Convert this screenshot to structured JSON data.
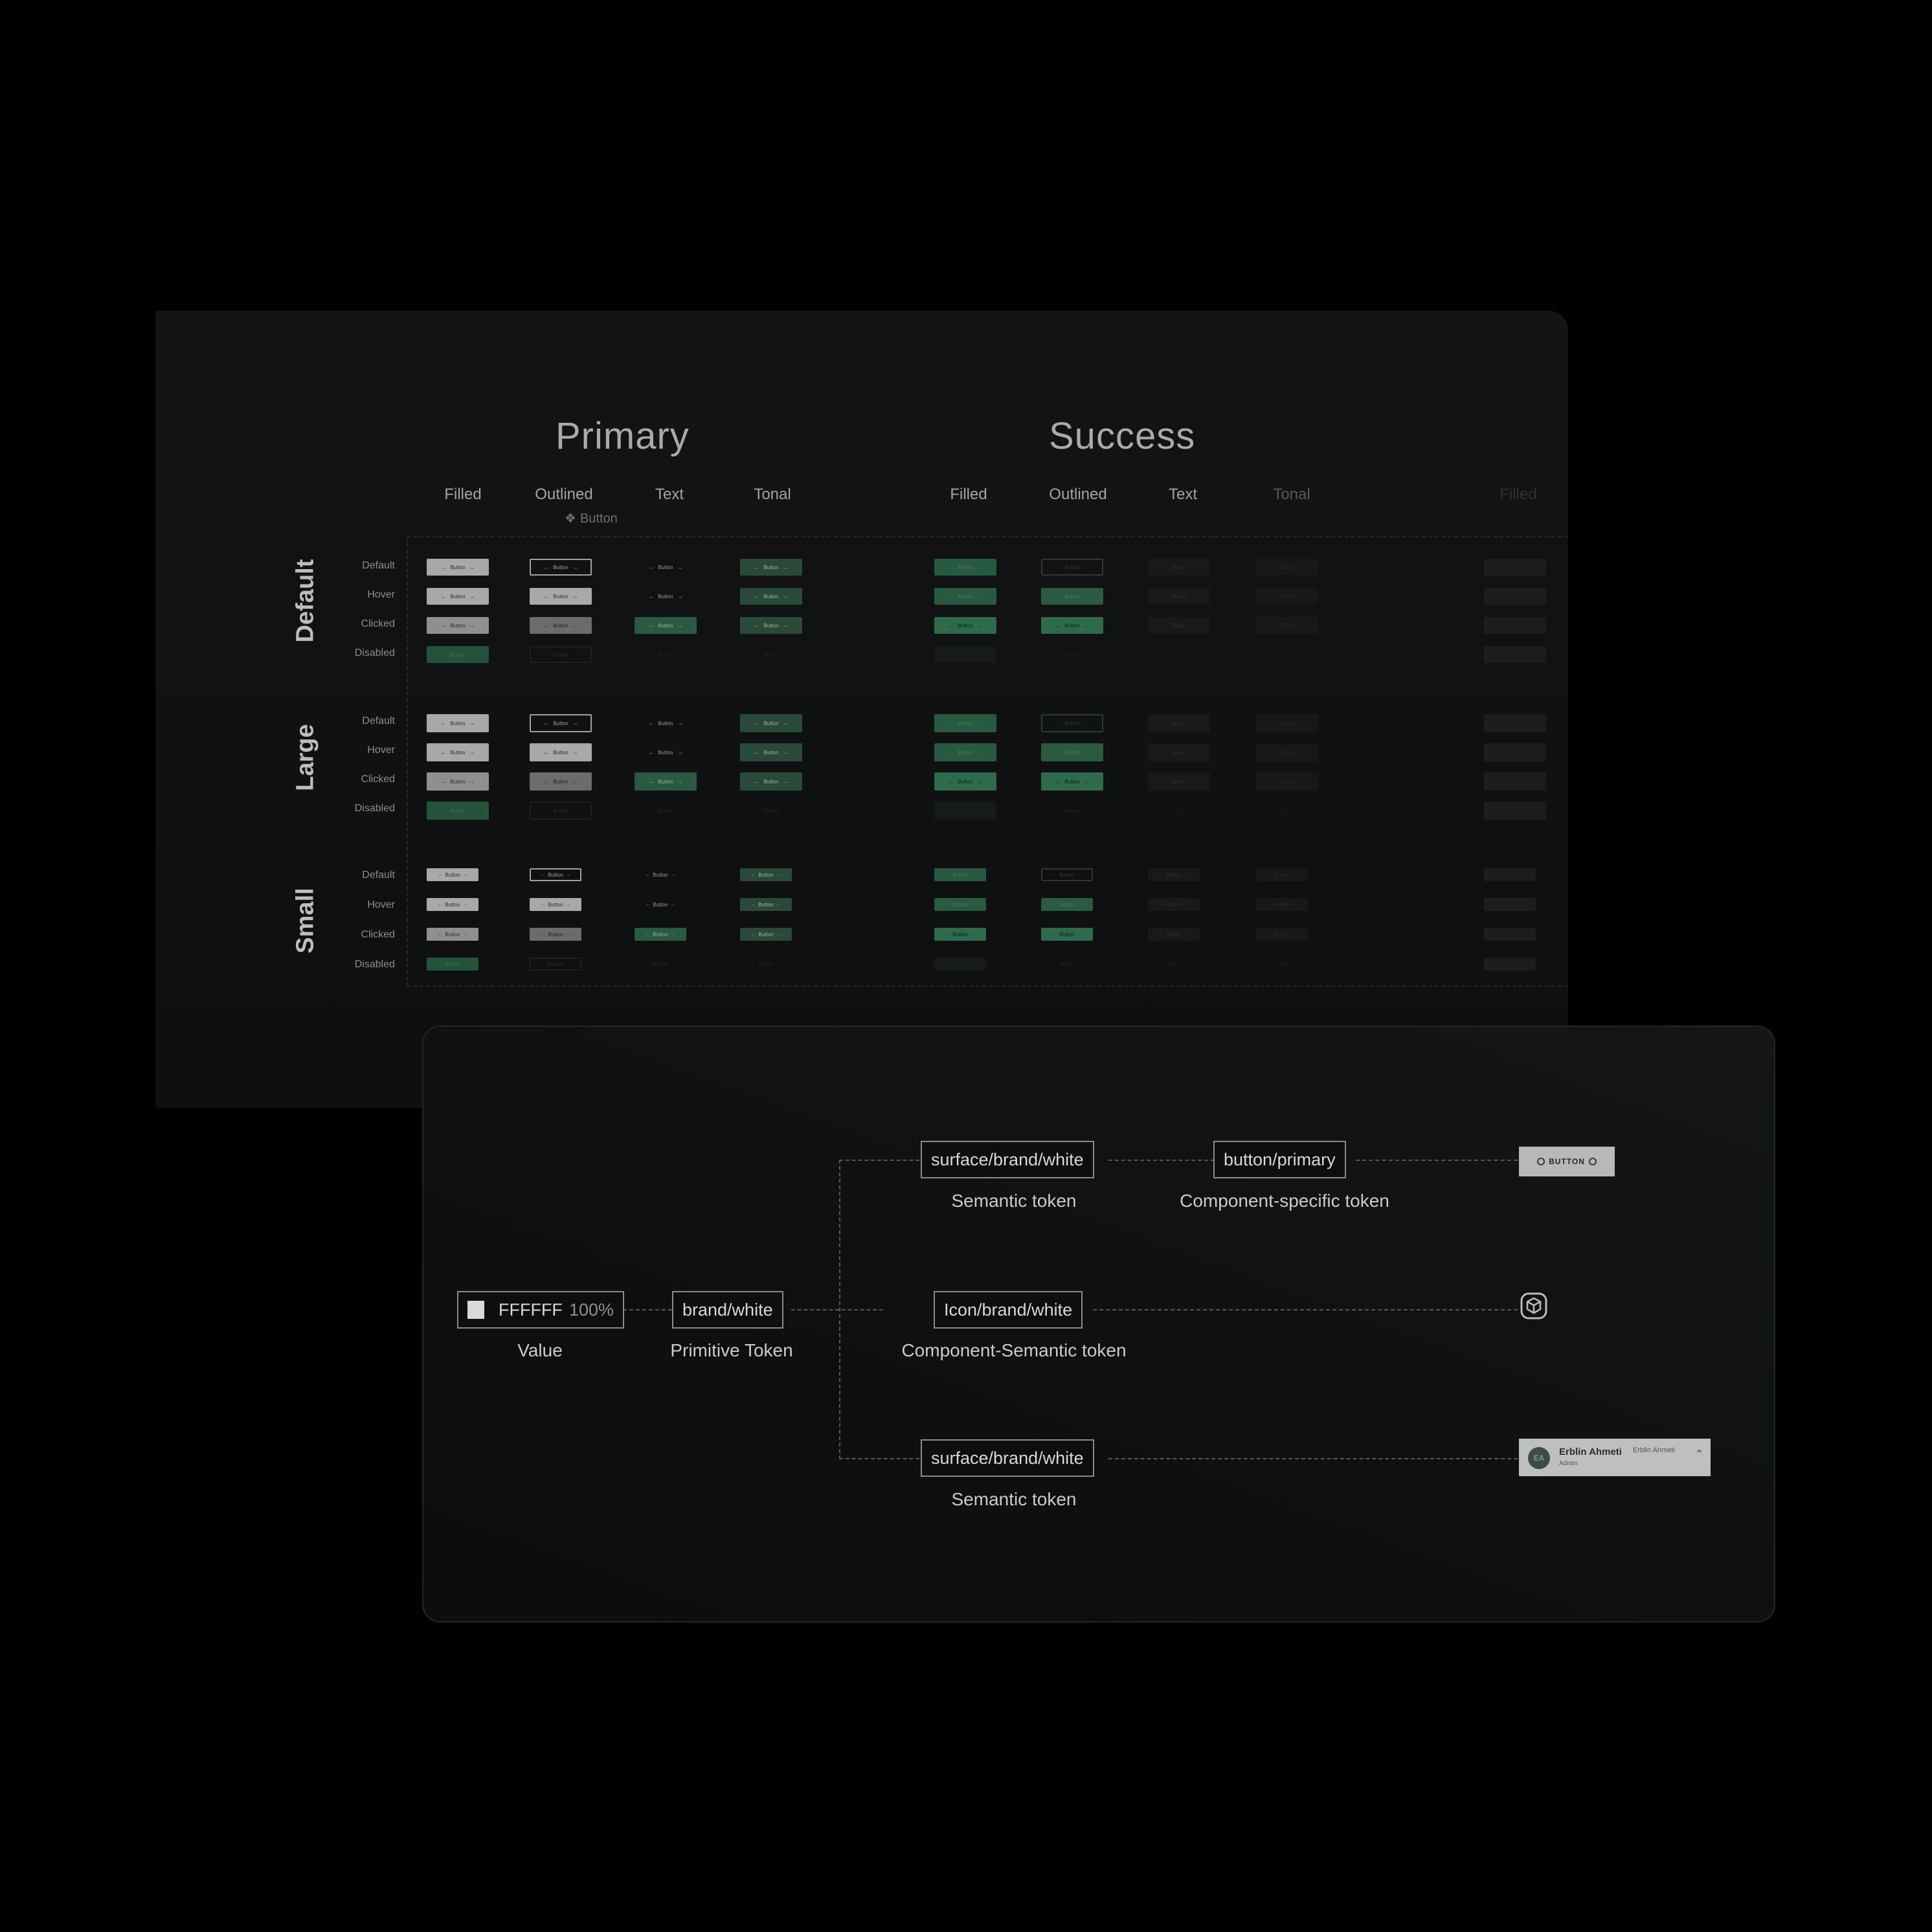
{
  "matrix": {
    "groups": [
      "Primary",
      "Success"
    ],
    "columns_primary": [
      "Filled",
      "Outlined",
      "Text",
      "Tonal"
    ],
    "columns_success": [
      "Filled",
      "Outlined",
      "Text",
      "Tonal"
    ],
    "column_extra": "Filled",
    "component_tag": "Button",
    "sections": [
      "Default",
      "Large",
      "Small"
    ],
    "states": [
      "Default",
      "Hover",
      "Clicked",
      "Disabled"
    ],
    "chip_label": "Button"
  },
  "tokens": {
    "value": {
      "hex": "FFFFFF",
      "opacity": "100%",
      "caption": "Value"
    },
    "primitive": {
      "label": "brand/white",
      "caption": "Primitive Token"
    },
    "semantic_top": {
      "label": "surface/brand/white",
      "caption": "Semantic token"
    },
    "component_specific": {
      "label": "button/primary",
      "caption": "Component-specific token"
    },
    "component_semantic": {
      "label": "Icon/brand/white",
      "caption": "Component-Semantic token"
    },
    "semantic_bottom": {
      "label": "surface/brand/white",
      "caption": "Semantic token"
    }
  },
  "previews": {
    "button_label": "BUTTON",
    "icon": "cube-in-rounded-square-icon",
    "user": {
      "initials": "EA",
      "name": "Erblin Ahmeti",
      "role": "Admin",
      "alt_name": "Erblin Ahmeti"
    }
  },
  "colors": {
    "background": "#000000",
    "panel": "#121314",
    "success_green": "#2d5a43",
    "token_border": "#8a8b8c"
  }
}
